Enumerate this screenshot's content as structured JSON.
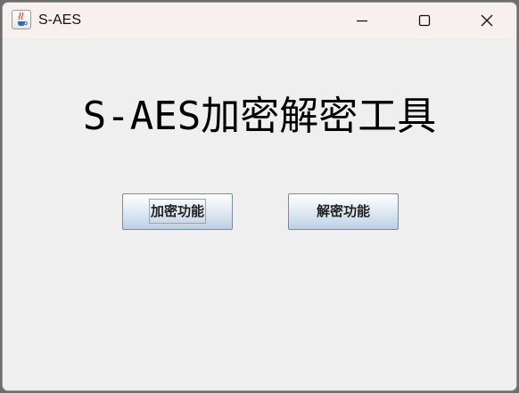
{
  "window": {
    "title": "S-AES",
    "app_icon": "java-cup-icon"
  },
  "controls": {
    "minimize": "minimize-icon",
    "maximize": "maximize-icon",
    "close": "close-icon"
  },
  "main": {
    "heading": "S-AES加密解密工具",
    "buttons": {
      "encrypt_label": "加密功能",
      "decrypt_label": "解密功能"
    }
  },
  "colors": {
    "titlebar": "#f8f0ee",
    "background": "#efefef",
    "button_border": "#7a8aa0"
  }
}
